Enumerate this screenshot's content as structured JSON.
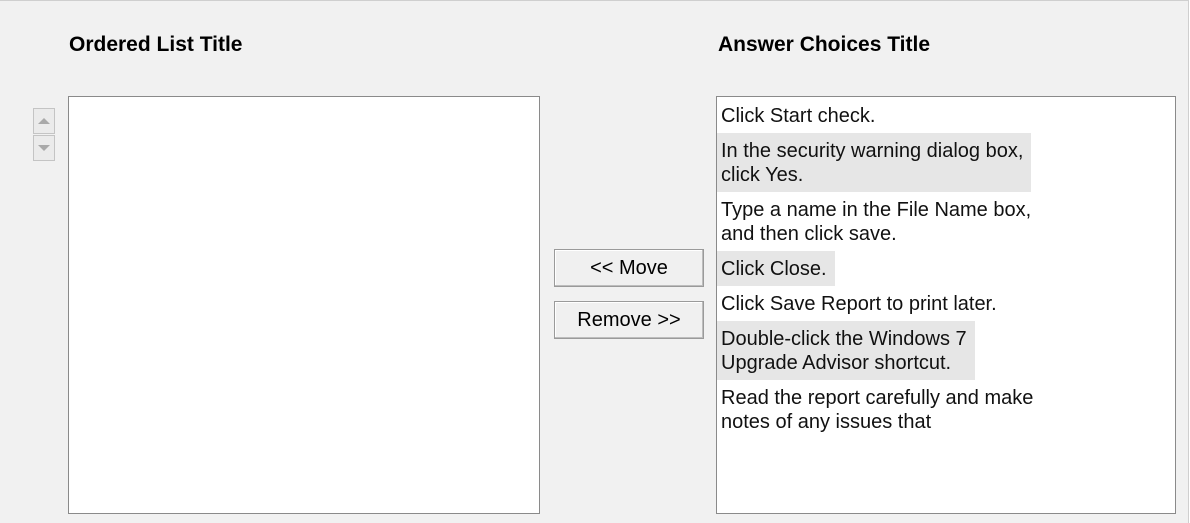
{
  "ordered_list": {
    "title": "Ordered List Title",
    "items": []
  },
  "answer_choices": {
    "title": "Answer Choices Title",
    "items": [
      "Click Start check.",
      "In the security warning dialog box,\nclick Yes.",
      "Type a name in the File Name box,\nand then click save.",
      "Click Close.",
      "Click Save Report to print later.",
      "Double-click the Windows 7\nUpgrade Advisor shortcut.",
      "Read the report carefully and make\nnotes of any issues that"
    ]
  },
  "buttons": {
    "move_label": "<< Move",
    "remove_label": "Remove >>"
  },
  "colors": {
    "panel_background": "#f1f1f1",
    "highlight_row": "#e6e6e6",
    "listbox_border": "#8a8a8a"
  }
}
